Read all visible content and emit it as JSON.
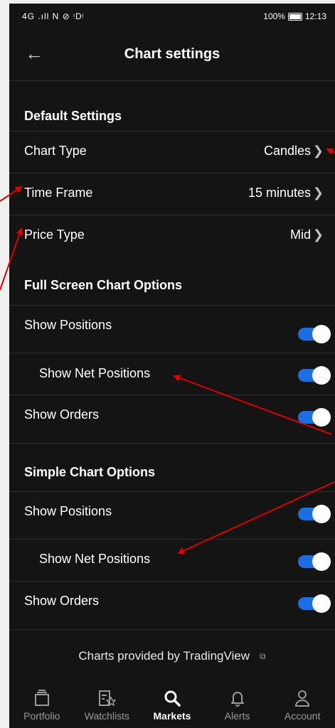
{
  "status": {
    "left": "4G .ıll N ⊘ ᵎDᵎ",
    "battery": "100%",
    "time": "12:13"
  },
  "header": {
    "title": "Chart settings"
  },
  "default_settings": {
    "heading": "Default Settings",
    "items": [
      {
        "label": "Chart Type",
        "value": "Candles"
      },
      {
        "label": "Time Frame",
        "value": "15 minutes"
      },
      {
        "label": "Price Type",
        "value": "Mid"
      }
    ]
  },
  "full_screen": {
    "heading": "Full Screen Chart Options",
    "items": [
      {
        "label": "Show Positions",
        "on": true
      },
      {
        "label": "Show Net Positions",
        "on": true
      },
      {
        "label": "Show Orders",
        "on": true
      }
    ]
  },
  "simple_chart": {
    "heading": "Simple Chart Options",
    "items": [
      {
        "label": "Show Positions",
        "on": true
      },
      {
        "label": "Show Net Positions",
        "on": true
      },
      {
        "label": "Show Orders",
        "on": true
      }
    ]
  },
  "footer": {
    "note": "Charts provided by TradingView"
  },
  "tabs": [
    {
      "label": "Portfolio",
      "icon": "portfolio-icon"
    },
    {
      "label": "Watchlists",
      "icon": "watchlist-icon"
    },
    {
      "label": "Markets",
      "icon": "search-icon",
      "active": true
    },
    {
      "label": "Alerts",
      "icon": "bell-icon"
    },
    {
      "label": "Account",
      "icon": "person-icon"
    }
  ],
  "colors": {
    "background": "#141414",
    "toggle_on": "#1a6fe3",
    "annotation_arrow": "#e00000"
  }
}
